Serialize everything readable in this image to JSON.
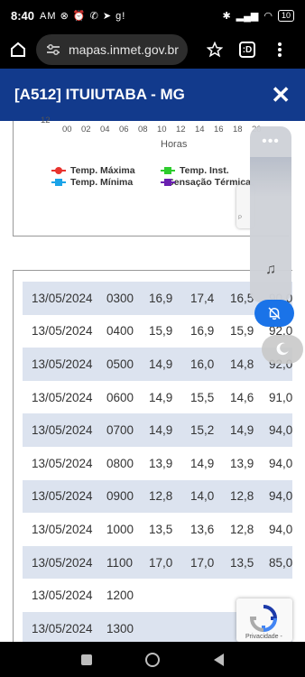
{
  "status_bar": {
    "time": "8:40",
    "status_icons": "AM ⊗ ⏰ ✆ ➤ g!",
    "battery": "10"
  },
  "browser": {
    "url": "mapas.inmet.gov.br",
    "tabs_count": ":D"
  },
  "header": {
    "title": "[A512] ITUIUTABA - MG",
    "close_label": "✕"
  },
  "chart": {
    "y_tick": "12",
    "x_ticks": [
      "00",
      "02",
      "04",
      "06",
      "08",
      "10",
      "12",
      "14",
      "16",
      "18",
      "20"
    ],
    "xlabel": "Horas",
    "legend": [
      {
        "label": "Temp. Máxima",
        "color": "#e8332e",
        "marker": "circle"
      },
      {
        "label": "Temp. Inst.",
        "color": "#2ecc2e",
        "marker": "diamond"
      },
      {
        "label": "Temp. Mínima",
        "color": "#1aa3e8",
        "marker": "square"
      },
      {
        "label": "Sensação Térmica",
        "color": "#6a1fb0",
        "marker": "triangle"
      }
    ],
    "sidebox_label": "P"
  },
  "table": {
    "rows": [
      {
        "date": "13/05/2024",
        "hour": "0300",
        "a": "16,9",
        "b": "17,4",
        "c": "16,5",
        "d": "90,0"
      },
      {
        "date": "13/05/2024",
        "hour": "0400",
        "a": "15,9",
        "b": "16,9",
        "c": "15,9",
        "d": "92,0"
      },
      {
        "date": "13/05/2024",
        "hour": "0500",
        "a": "14,9",
        "b": "16,0",
        "c": "14,8",
        "d": "92,0"
      },
      {
        "date": "13/05/2024",
        "hour": "0600",
        "a": "14,9",
        "b": "15,5",
        "c": "14,6",
        "d": "91,0"
      },
      {
        "date": "13/05/2024",
        "hour": "0700",
        "a": "14,9",
        "b": "15,2",
        "c": "14,9",
        "d": "94,0"
      },
      {
        "date": "13/05/2024",
        "hour": "0800",
        "a": "13,9",
        "b": "14,9",
        "c": "13,9",
        "d": "94,0"
      },
      {
        "date": "13/05/2024",
        "hour": "0900",
        "a": "12,8",
        "b": "14,0",
        "c": "12,8",
        "d": "94,0"
      },
      {
        "date": "13/05/2024",
        "hour": "1000",
        "a": "13,5",
        "b": "13,6",
        "c": "12,8",
        "d": "94,0"
      },
      {
        "date": "13/05/2024",
        "hour": "1100",
        "a": "17,0",
        "b": "17,0",
        "c": "13,5",
        "d": "85,0"
      },
      {
        "date": "13/05/2024",
        "hour": "1200",
        "a": "",
        "b": "",
        "c": "",
        "d": ""
      },
      {
        "date": "13/05/2024",
        "hour": "1300",
        "a": "",
        "b": "",
        "c": "",
        "d": ""
      }
    ]
  },
  "recaptcha": {
    "label": "Privacidade -"
  }
}
